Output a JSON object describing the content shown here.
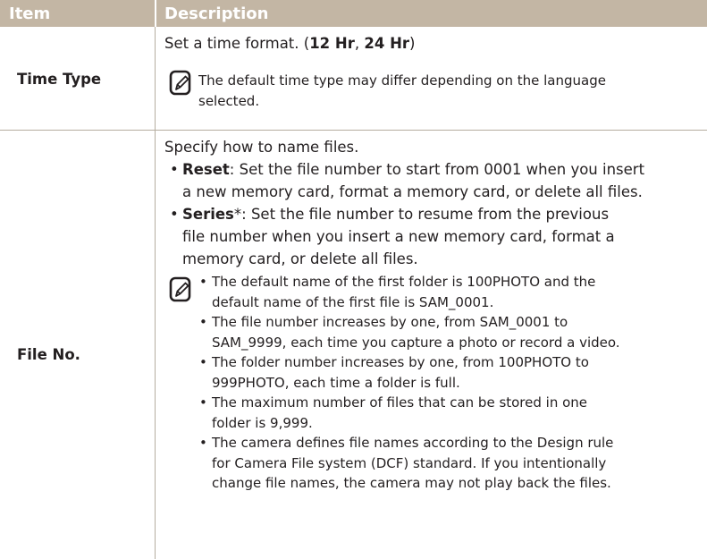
{
  "header": {
    "item": "Item",
    "description": "Description"
  },
  "rows": [
    {
      "item": "Time Type",
      "intro": "Set a time format. (",
      "opt1": "12 Hr",
      "sep": ", ",
      "opt2": "24 Hr",
      "close": ")",
      "note": [
        "The default time type may differ depending on the language",
        "selected."
      ]
    },
    {
      "item": "File No.",
      "intro": "Specify how to name files.",
      "options": [
        {
          "term": "Reset",
          "lines": [
            ": Set the file number to start from 0001 when you insert",
            "a new memory card, format a memory card, or delete all files."
          ]
        },
        {
          "term": "Series",
          "lines": [
            "*: Set the file number to resume from the previous",
            "file number when you insert a new memory card, format a",
            "memory card, or delete all files."
          ]
        }
      ],
      "notes": [
        [
          "The default name of the first folder is 100PHOTO and the",
          "default name of the first file is SAM_0001."
        ],
        [
          "The file number increases by one, from SAM_0001 to",
          "SAM_9999, each time you capture a photo or record a video."
        ],
        [
          "The folder number increases by one, from 100PHOTO to",
          "999PHOTO, each time a folder is full."
        ],
        [
          "The maximum number of files that can be stored in one",
          "folder is 9,999."
        ],
        [
          "The camera defines file names according to the Design rule",
          "for Camera File system (DCF) standard. If you intentionally",
          "change file names, the camera may not play back the files."
        ]
      ]
    }
  ],
  "bullet": "•",
  "icon": "note-pencil-icon",
  "colors": {
    "header_bg": "#c3b6a4",
    "rule": "#b5ad9f",
    "text": "#231f20"
  }
}
